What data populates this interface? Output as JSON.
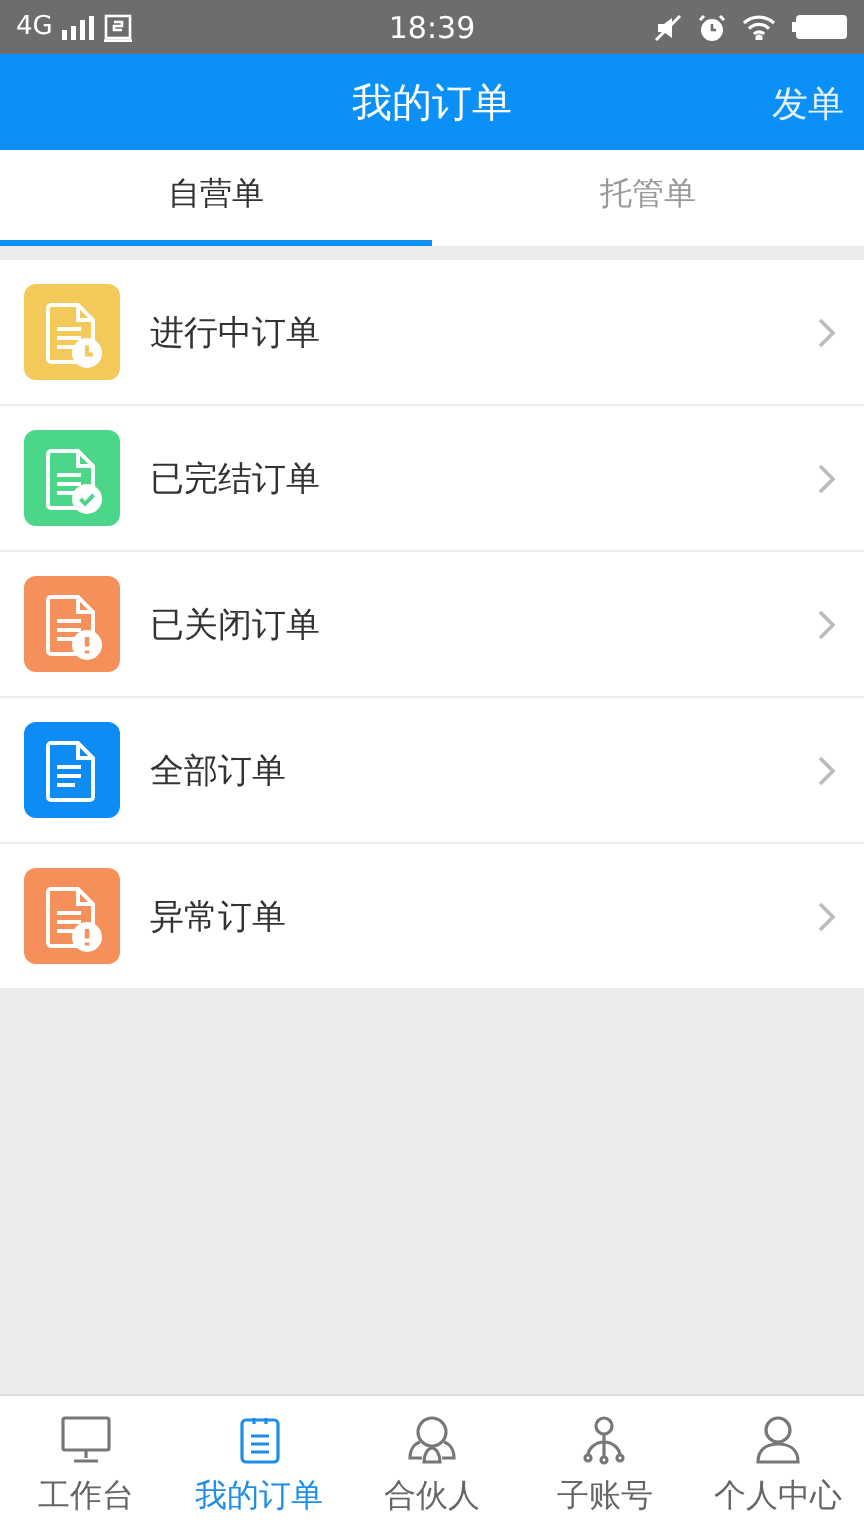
{
  "status_bar": {
    "network": "4G",
    "time": "18:39"
  },
  "header": {
    "title": "我的订单",
    "action": "发单"
  },
  "tabs": [
    {
      "label": "自营单",
      "selected": true
    },
    {
      "label": "托管单",
      "selected": false
    }
  ],
  "orders": [
    {
      "label": "进行中订单",
      "color": "#f3c95a",
      "kind": "clock"
    },
    {
      "label": "已完结订单",
      "color": "#4cd68a",
      "kind": "check"
    },
    {
      "label": "已关闭订单",
      "color": "#f5905a",
      "kind": "alert"
    },
    {
      "label": "全部订单",
      "color": "#0e8cf5",
      "kind": "plain"
    },
    {
      "label": "异常订单",
      "color": "#f5905a",
      "kind": "alert"
    }
  ],
  "bottom_nav": [
    {
      "label": "工作台",
      "kind": "monitor",
      "selected": false
    },
    {
      "label": "我的订单",
      "kind": "clipboard",
      "selected": true
    },
    {
      "label": "合伙人",
      "kind": "partners",
      "selected": false
    },
    {
      "label": "子账号",
      "kind": "tree",
      "selected": false
    },
    {
      "label": "个人中心",
      "kind": "person",
      "selected": false
    }
  ]
}
